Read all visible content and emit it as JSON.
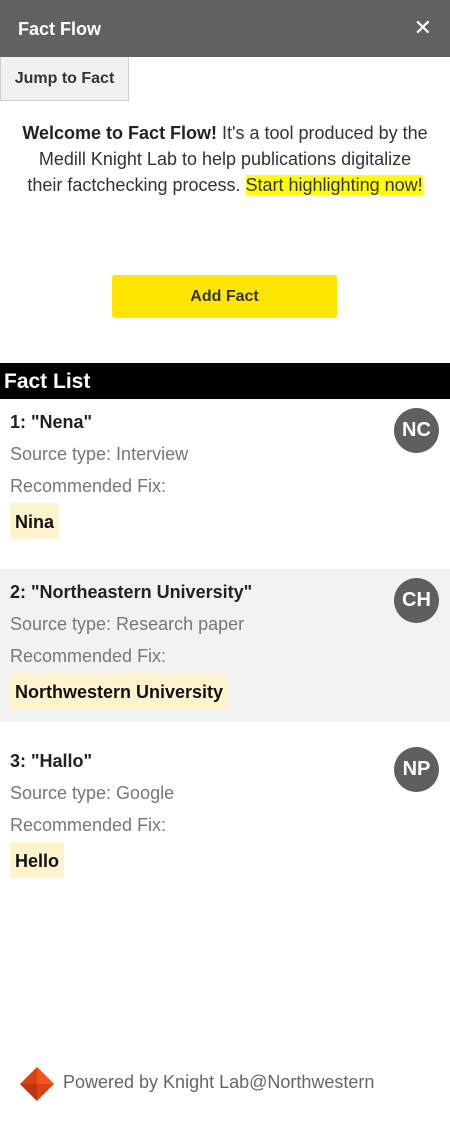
{
  "app": {
    "title": "Fact Flow",
    "close_icon": "close-icon"
  },
  "toolbar": {
    "jump_label": "Jump to Fact"
  },
  "welcome": {
    "bold": "Welcome to Fact Flow!",
    "text": " It's a tool produced by the Medill Knight Lab to help publications digitalize their factchecking process. ",
    "highlight": "Start highlighting now!",
    "highlight_color": "#ffff00"
  },
  "add_fact": {
    "label": "Add Fact",
    "color": "#ffe600"
  },
  "fact_list": {
    "header": "Fact List",
    "facts": [
      {
        "title": "1: \"Nena\"",
        "source": "Source type: Interview",
        "recommended_label": "Recommended Fix:",
        "fix": "Nina",
        "initials": "NC"
      },
      {
        "title": "2: \"Northeastern University\"",
        "source": "Source type: Research paper",
        "recommended_label": "Recommended Fix:",
        "fix": "Northwestern University",
        "initials": "CH"
      },
      {
        "title": "3: \"Hallo\"",
        "source": "Source type: Google",
        "recommended_label": "Recommended Fix:",
        "fix": "Hello",
        "initials": "NP"
      }
    ]
  },
  "footer": {
    "text": "Powered by Knight Lab@Northwestern",
    "logo_icon": "knight-lab-logo-icon"
  }
}
